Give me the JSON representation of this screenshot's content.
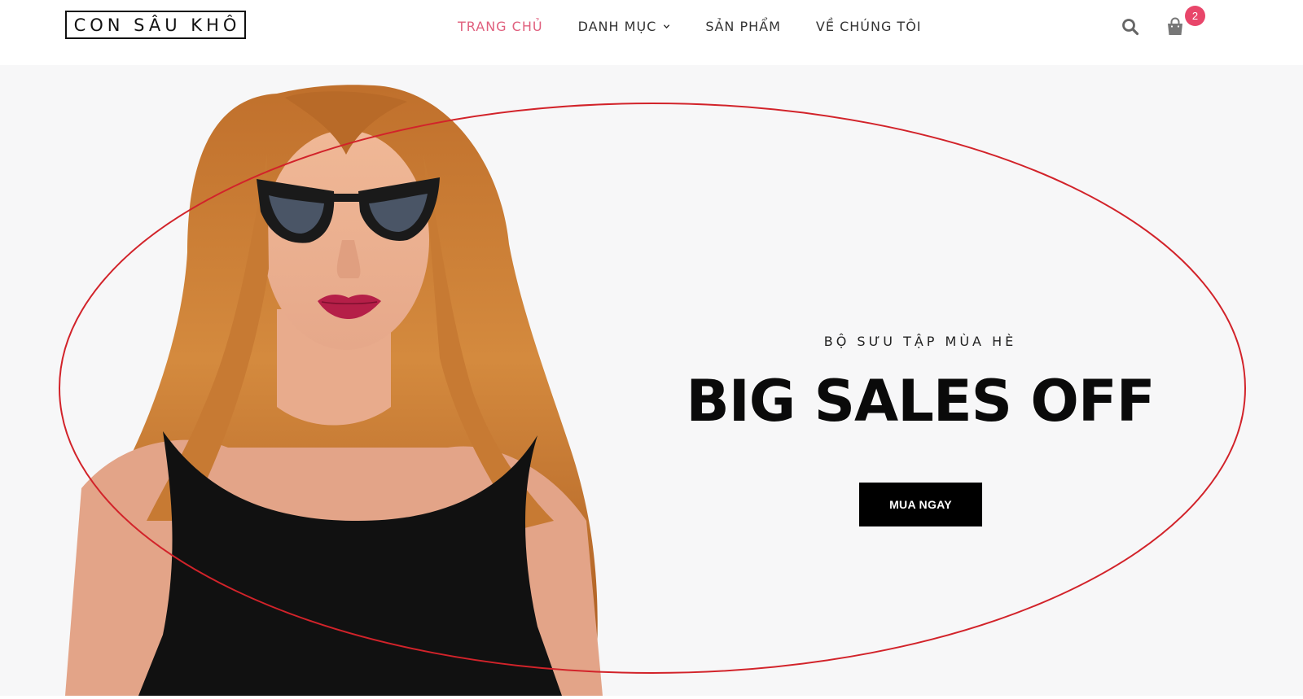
{
  "header": {
    "logo_text": "CON SÂU KHÔ",
    "nav": [
      {
        "label": "TRANG CHỦ",
        "active": true
      },
      {
        "label": "DANH MỤC",
        "has_dropdown": true
      },
      {
        "label": "SẢN PHẨM"
      },
      {
        "label": "VỀ CHÚNG TÔI"
      }
    ],
    "icons": {
      "search": "search-icon",
      "cart": "shopping-bag-icon"
    },
    "cart_count": "2"
  },
  "hero": {
    "subtitle": "BỘ SƯU TẬP MÙA HÈ",
    "headline": "BIG SALES OFF",
    "cta_label": "MUA NGAY",
    "image": "woman-with-sunglasses-photo"
  },
  "annotation": {
    "shape": "ellipse",
    "color": "#d2232a"
  },
  "colors": {
    "accent": "#e0607e",
    "badge": "#e8466a",
    "hero_background": "#f7f7f8",
    "button": "#000000"
  }
}
